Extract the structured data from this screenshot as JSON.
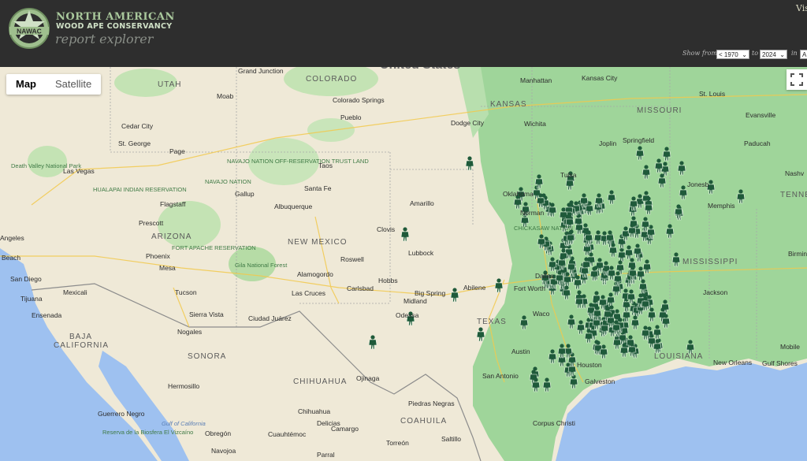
{
  "brand": {
    "line1": "NORTH AMERICAN",
    "line2": "WOOD APE CONSERVANCY",
    "line3": "report explorer",
    "badge_text": "NAWAC"
  },
  "nav": {
    "visible_label": "Vis"
  },
  "filters": {
    "show_from_label": "Show from",
    "from_value": "< 1970",
    "to_label": "to",
    "to_value": "2024",
    "in_label": "in",
    "in_value": "A"
  },
  "map_toggle": {
    "map_label": "Map",
    "satellite_label": "Satellite",
    "active": "Map"
  },
  "map": {
    "partial_title": "United States",
    "states": [
      "UTAH",
      "COLORADO",
      "KANSAS",
      "MISSOURI",
      "ARIZONA",
      "NEW MEXICO",
      "TEXAS",
      "MISSISSIPPI",
      "LOUISIANA",
      "TENNES",
      "BAJA",
      "CALIFORNIA",
      "SONORA",
      "CHIHUAHUA",
      "COAHUILA"
    ],
    "cities": [
      "Grand Junction",
      "Moab",
      "Cedar City",
      "St. George",
      "Page",
      "Colorado Springs",
      "Pueblo",
      "Manhattan",
      "Kansas City",
      "Wichita",
      "Dodge City",
      "Springfield",
      "Joplin",
      "St. Louis",
      "Evansville",
      "Paducah",
      "Las Vegas",
      "Flagstaff",
      "Prescott",
      "Phoenix",
      "Mesa",
      "Tucson",
      "Sierra Vista",
      "Nogales",
      "Santa Fe",
      "Albuquerque",
      "Gallup",
      "Taos",
      "Amarillo",
      "Clovis",
      "Lubbock",
      "Roswell",
      "Alamogordo",
      "Las Cruces",
      "Carlsbad",
      "Hobbs",
      "Oklahoma",
      "Norman",
      "Tulsa",
      "Memphis",
      "Dallas",
      "Fort Worth",
      "Waco",
      "Abilene",
      "Big Spring",
      "Midland",
      "Odessa",
      "Ciudad Juárez",
      "Austin",
      "San Antonio",
      "Houston",
      "Galveston",
      "Corpus Christi",
      "New Orleans",
      "Jackson",
      "Mobile",
      "Gulf Shores",
      "Nashv",
      "San Diego",
      "Tijuana",
      "Mexicali",
      "Ensenada",
      "Angeles",
      "Beach",
      "Hermosillo",
      "Chihuahua",
      "Delicias",
      "Cuauhtémoc",
      "Obregón",
      "Navojoa",
      "Piedras Negras",
      "Saltillo",
      "Ojinaga",
      "Guerrero Negro",
      "Torreón",
      "Parral",
      "Camargo",
      "Jonesb",
      "Birming"
    ],
    "parks": [
      "Death Valley National Park",
      "NAVAJO NATION OFF-RESERVATION TRUST LAND",
      "NAVAJO NATION",
      "HUALAPAI INDIAN RESERVATION",
      "FORT APACHE RESERVATION",
      "Gila National Forest",
      "CHICKASAW NATION",
      "Reserva de la Biosfera El Vizcaíno",
      "Gulf of California"
    ],
    "report_count": 230
  }
}
